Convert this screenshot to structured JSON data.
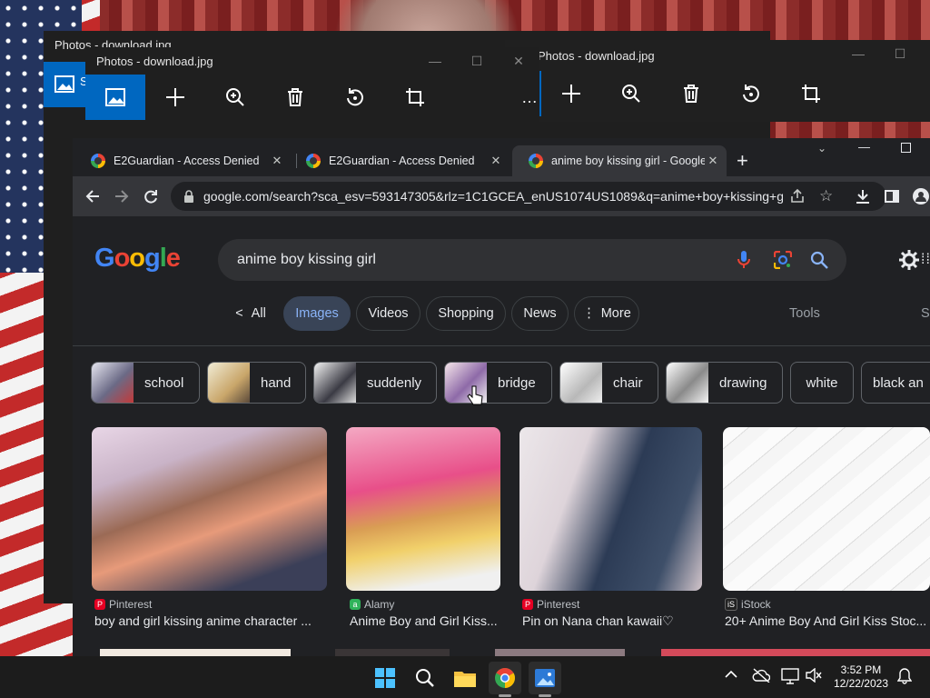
{
  "photos_back": {
    "title": "Photos - download.jpg",
    "share_label": "S"
  },
  "photos_mid": {
    "title": "Photos - download.jpg"
  },
  "photos_front": {
    "title": "Photos - download.jpg",
    "more_label": "…"
  },
  "chrome": {
    "tabs": [
      {
        "title": "E2Guardian - Access Denied"
      },
      {
        "title": "E2Guardian - Access Denied"
      },
      {
        "title": "anime boy kissing girl - Google"
      }
    ],
    "url": "google.com/search?sca_esv=593147305&rlz=1C1GCEA_enUS1074US1089&q=anime+boy+kissing+g..."
  },
  "google": {
    "logo": [
      "G",
      "o",
      "o",
      "g",
      "l",
      "e"
    ],
    "logo_colors": [
      "#4285f4",
      "#ea4335",
      "#fbbc05",
      "#4285f4",
      "#34a853",
      "#ea4335"
    ],
    "query": "anime boy kissing girl",
    "nav": [
      "All",
      "Images",
      "Videos",
      "Shopping",
      "News",
      "More"
    ],
    "tools": "Tools",
    "safe_partial": "S",
    "chips": [
      "school",
      "hand",
      "suddenly",
      "bridge",
      "chair",
      "drawing",
      "white",
      "black an"
    ],
    "results": [
      {
        "source": "Pinterest",
        "title": "boy and girl kissing anime character ..."
      },
      {
        "source": "Alamy",
        "title": "Anime Boy and Girl Kiss..."
      },
      {
        "source": "Pinterest",
        "title": "Pin on Nana chan kawaii♡"
      },
      {
        "source": "iStock",
        "title": "20+ Anime Boy And Girl Kiss Stoc..."
      }
    ],
    "source_colors": {
      "Pinterest": "#e60023",
      "Alamy": "#2fb35a",
      "iStock": "#222222"
    }
  },
  "taskbar": {
    "time": "3:52 PM",
    "date": "12/22/2023"
  }
}
